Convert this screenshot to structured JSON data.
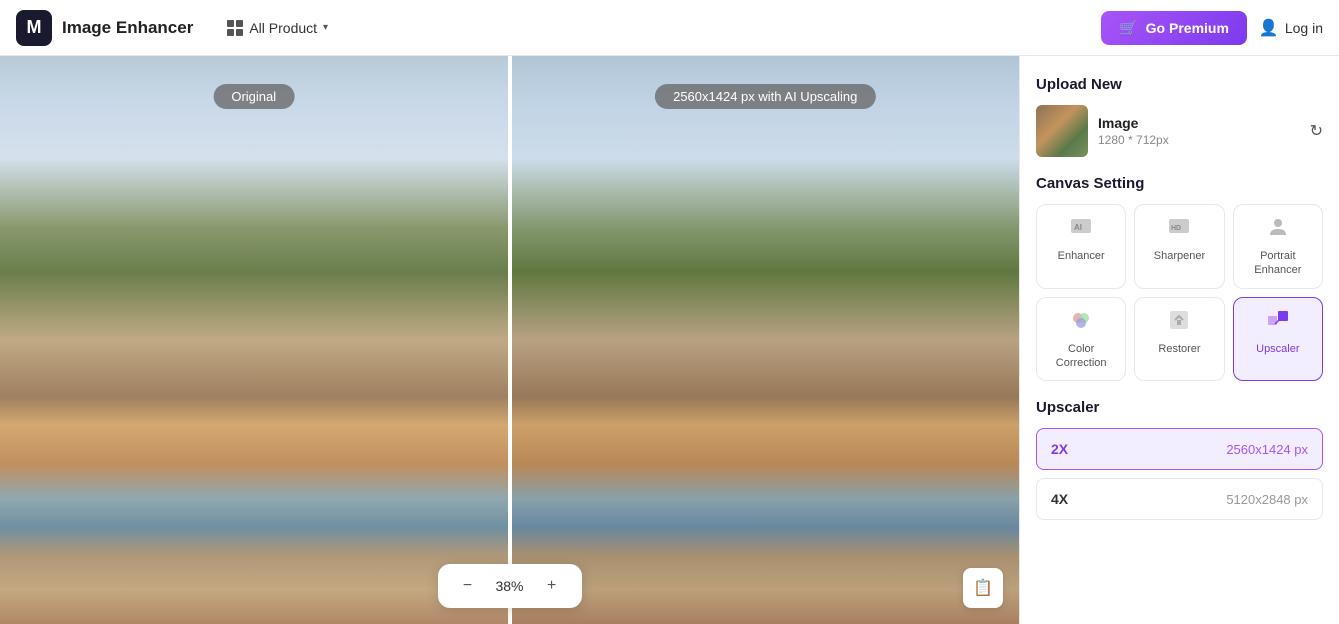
{
  "header": {
    "logo_text": "M",
    "app_name": "Image Enhancer",
    "all_product_label": "All Product",
    "go_premium_label": "Go Premium",
    "login_label": "Log in"
  },
  "canvas": {
    "original_label": "Original",
    "upscaled_label": "2560x1424 px with AI Upscaling",
    "zoom_level": "38%"
  },
  "right_panel": {
    "upload_section_title": "Upload New",
    "image_name": "Image",
    "image_dimensions": "1280 * 712px",
    "canvas_setting_title": "Canvas Setting",
    "tools": [
      {
        "id": "enhancer",
        "label": "Enhancer",
        "icon": "ai-enhance"
      },
      {
        "id": "sharpener",
        "label": "Sharpener",
        "icon": "hd-sharp"
      },
      {
        "id": "portrait",
        "label": "Portrait\nEnhancer",
        "icon": "portrait"
      },
      {
        "id": "color",
        "label": "Color\nCorrection",
        "icon": "color"
      },
      {
        "id": "restorer",
        "label": "Restorer",
        "icon": "restore"
      },
      {
        "id": "upscaler",
        "label": "Upscaler",
        "icon": "upscale",
        "active": true
      }
    ],
    "upscaler_title": "Upscaler",
    "upscaler_options": [
      {
        "id": "2x",
        "label": "2X",
        "size": "2560x1424 px",
        "active": true
      },
      {
        "id": "4x",
        "label": "4X",
        "size": "5120x2848 px",
        "active": false
      }
    ]
  }
}
